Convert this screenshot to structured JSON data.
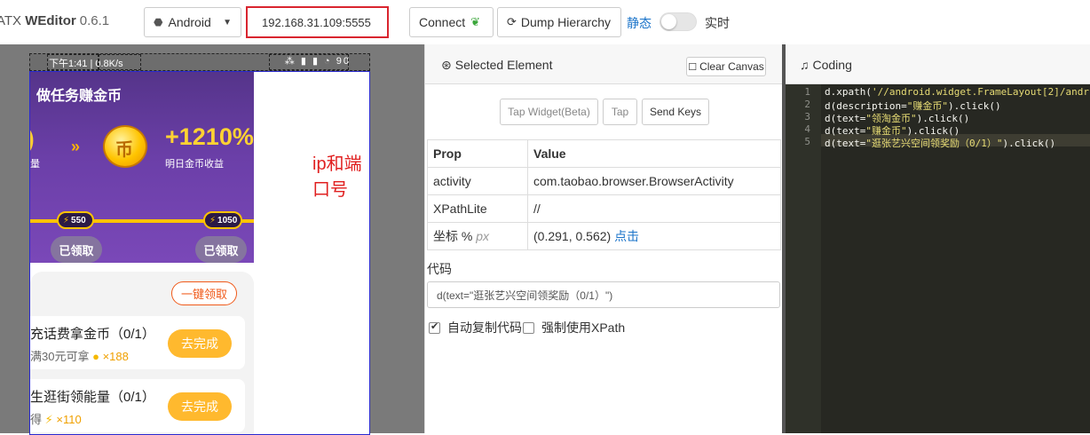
{
  "toolbar": {
    "app_name_prefix": "ATX ",
    "app_name": "WEditor",
    "version": "0.6.1",
    "platform": "Android",
    "ip_value": "192.168.31.109:5555",
    "connect_label": "Connect",
    "dump_label": "Dump Hierarchy",
    "static_label": "静态",
    "realtime_label": "实时"
  },
  "device": {
    "status_left": "下午1:41 | 0.8K/s",
    "status_right": "⁂ ▮ ▮ ◔ 90",
    "annotation": "ip和端口号",
    "hero": {
      "title": "做任务赚金币",
      "left_digit": ")",
      "left_sub": "量",
      "arrows": "»",
      "percent": "+1210%",
      "sub": "明日金币收益",
      "milestone_1": "550",
      "milestone_2": "1050",
      "claimed_1": "已领取",
      "claimed_2": "已领取"
    },
    "one_click": "一键领取",
    "tasks": [
      {
        "title": "充话费拿金币（0/1）",
        "sub": "满30元可拿",
        "reward": "×188",
        "button": "去完成"
      },
      {
        "title": "生逛街领能量（0/1）",
        "sub": "得",
        "reward": "×110",
        "button": "去完成"
      }
    ]
  },
  "inspector": {
    "header": "Selected Element",
    "clear_canvas": "Clear Canvas",
    "tap_widget": "Tap Widget(Beta)",
    "tap": "Tap",
    "send_keys": "Send Keys",
    "col_prop": "Prop",
    "col_value": "Value",
    "rows": [
      {
        "prop": "activity",
        "value": "com.taobao.browser.BrowserActivity"
      },
      {
        "prop": "XPathLite",
        "value": "//"
      }
    ],
    "coord_prop": "坐标 %",
    "coord_unit": "px",
    "coord_value": "(0.291, 0.562)",
    "coord_link": "点击",
    "code_label": "代码",
    "code_value": "d(text=\"逛张艺兴空间领奖励（0/1）\")",
    "auto_copy": "自动复制代码",
    "force_xpath": "强制使用XPath"
  },
  "coding": {
    "header": "Coding",
    "line_numbers": [
      "1",
      "2",
      "3",
      "4",
      "5"
    ],
    "lines": [
      {
        "pre": "d.xpath(",
        "str": "'//android.widget.FrameLayout[2]/andr",
        "post": ""
      },
      {
        "pre": "d(description=",
        "str": "\"赚金币\"",
        "post": ").click()"
      },
      {
        "pre": "d(text=",
        "str": "\"领淘金币\"",
        "post": ").click()"
      },
      {
        "pre": "d(text=",
        "str": "\"赚金币\"",
        "post": ").click()"
      },
      {
        "pre": "d(text=",
        "str": "\"逛张艺兴空间领奖励（0/1）\"",
        "post": ").click()"
      }
    ]
  }
}
